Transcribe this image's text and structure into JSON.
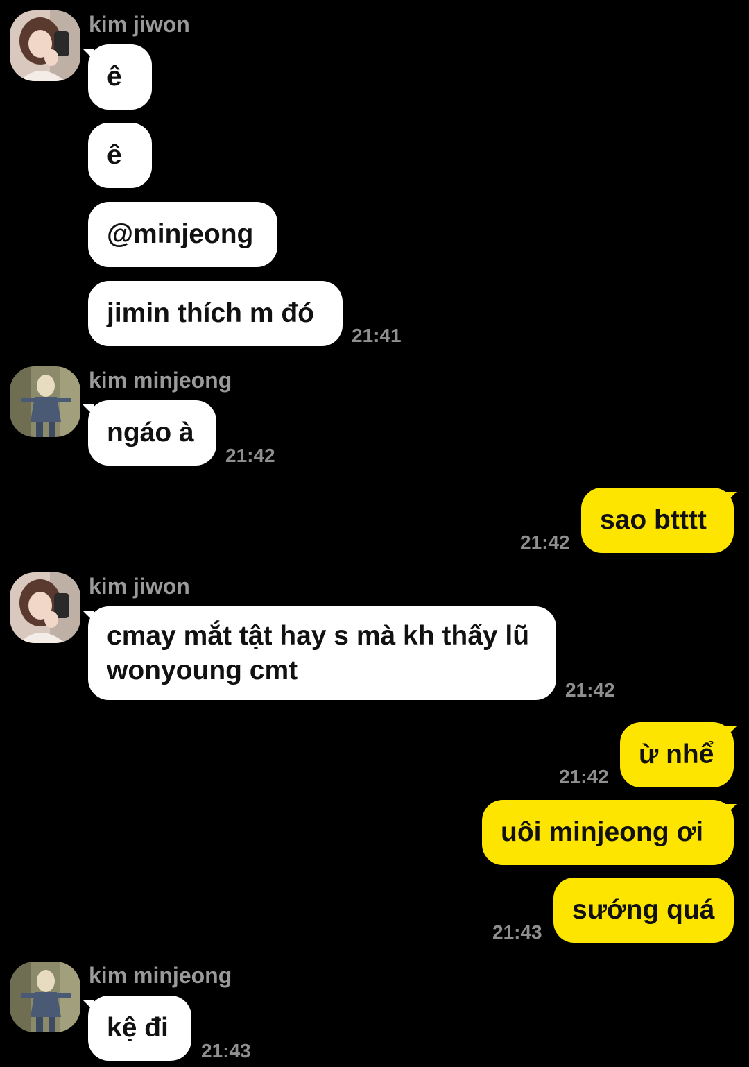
{
  "colors": {
    "background": "#000000",
    "incoming_bubble": "#ffffff",
    "outgoing_bubble": "#fee500",
    "name_text": "#9a9a9a",
    "time_text": "#8f8f8f"
  },
  "groups": [
    {
      "sender": "kim jiwon",
      "avatar_icon": "profile-photo-jiwon",
      "messages": [
        "ê",
        "ê",
        "@minjeong",
        "jimin thích m đó"
      ],
      "time": "21:41"
    },
    {
      "sender": "kim minjeong",
      "avatar_icon": "profile-photo-minjeong",
      "messages": [
        "ngáo à"
      ],
      "time": "21:42"
    },
    {
      "sender": "me",
      "messages": [
        "sao btttt"
      ],
      "time": "21:42"
    },
    {
      "sender": "kim jiwon",
      "avatar_icon": "profile-photo-jiwon",
      "messages": [
        "cmay mắt tật hay s mà kh thấy lũ wonyoung cmt"
      ],
      "time": "21:42"
    },
    {
      "sender": "me",
      "messages": [
        "ừ nhể"
      ],
      "time": "21:42"
    },
    {
      "sender": "me",
      "messages": [
        "uôi minjeong ơi",
        "sướng quá"
      ],
      "time": "21:43"
    },
    {
      "sender": "kim minjeong",
      "avatar_icon": "profile-photo-minjeong",
      "messages": [
        "kệ đi"
      ],
      "time": "21:43"
    }
  ]
}
